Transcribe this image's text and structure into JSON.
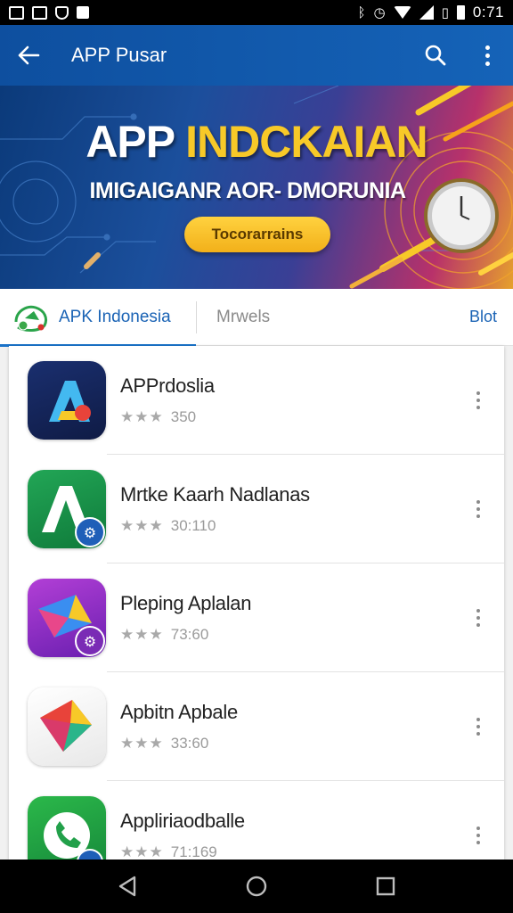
{
  "status_bar": {
    "time": "0:71",
    "left_icons": [
      "image-icon",
      "notification-icon",
      "shield-icon",
      "square-icon"
    ],
    "right_icons": [
      "bluetooth-icon",
      "alarm-icon",
      "wifi-icon",
      "signal-icon",
      "vibrate-icon",
      "battery-icon"
    ]
  },
  "app_bar": {
    "title": "APP Pusar",
    "back_icon": "arrow-left-icon",
    "search_icon": "search-icon",
    "menu_icon": "more-vert-icon"
  },
  "banner": {
    "title_white": "APP ",
    "title_yellow": "INDCKAIAN",
    "subtitle": "IMIGAIGANR AOR- DMORUNIA",
    "button_label": "Tocorarrains",
    "colors": {
      "accent": "#f7c928",
      "deep_blue": "#0b3a7a"
    }
  },
  "tabs": {
    "primary": "APK Indonesia",
    "secondary": "Mrwels",
    "more": "Blot"
  },
  "apps": [
    {
      "name": "APPrdoslia",
      "rating": 3,
      "reviews": "350",
      "icon": "blue-a-app-icon"
    },
    {
      "name": "Mrtke Kaarh Nadlanas",
      "rating": 3,
      "reviews": "30:110",
      "icon": "green-a-app-icon"
    },
    {
      "name": "Pleping Aplalan",
      "rating": 3,
      "reviews": "73:60",
      "icon": "purple-kite-app-icon"
    },
    {
      "name": "Apbitn Apbale",
      "rating": 3,
      "reviews": "33:60",
      "icon": "color-gem-app-icon"
    },
    {
      "name": "Appliriaodballe",
      "rating": 3,
      "reviews": "71:169",
      "icon": "green-phone-app-icon"
    }
  ],
  "stars_display": "★★★",
  "nav_bar": {
    "buttons": [
      "back-nav-icon",
      "home-nav-icon",
      "recents-nav-icon"
    ]
  }
}
